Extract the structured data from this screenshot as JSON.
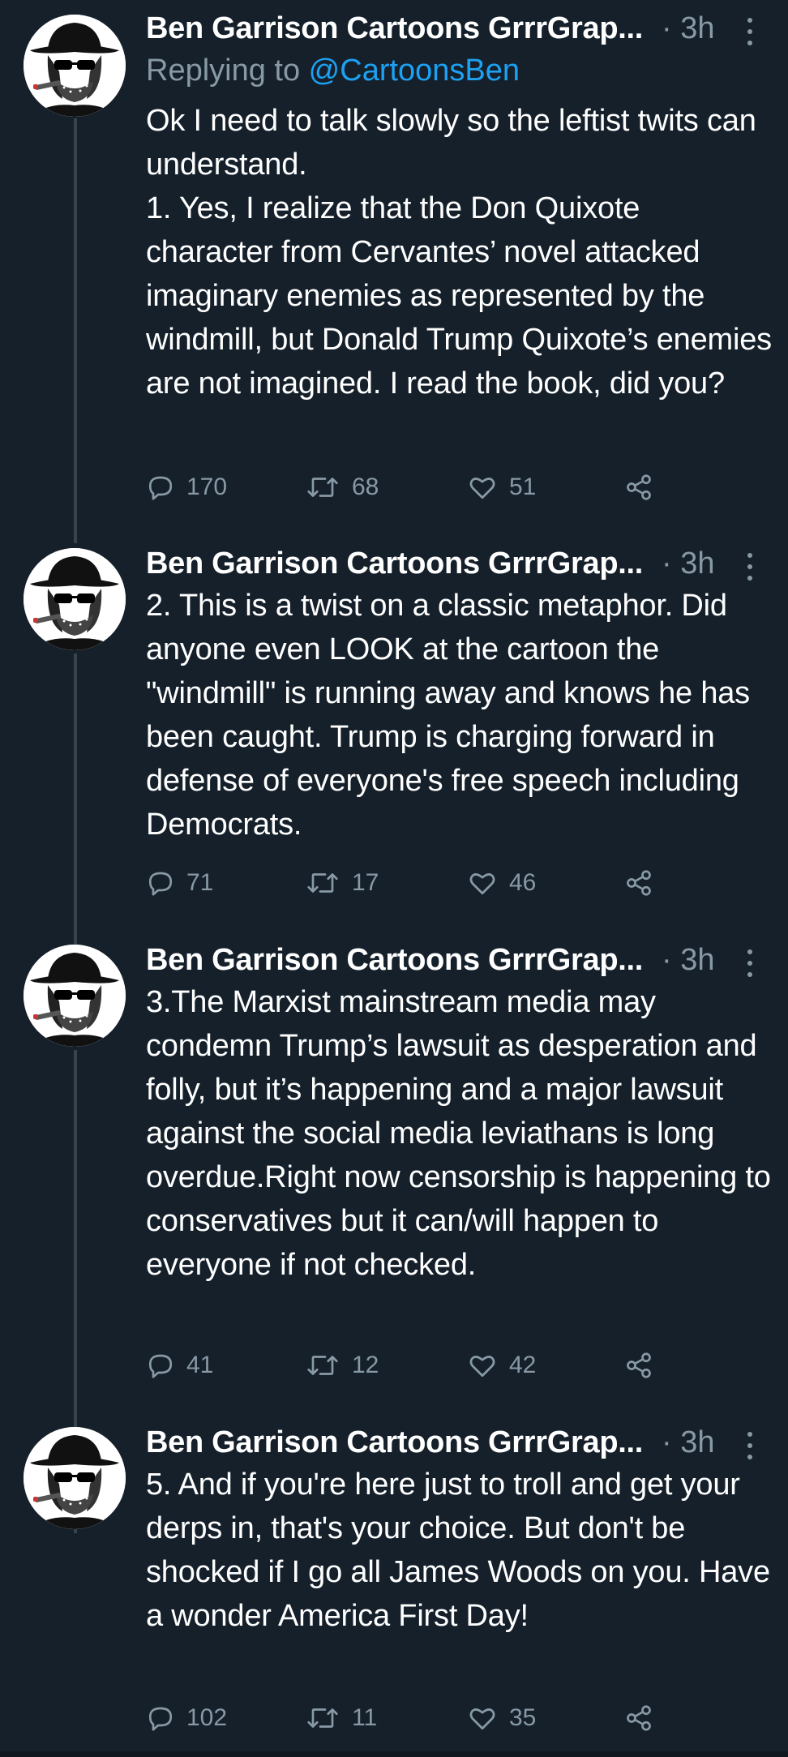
{
  "colors": {
    "background": "#15202b",
    "text_primary": "#ffffff",
    "text_secondary": "#8899a6",
    "link": "#1da1f2",
    "thread_line": "#38444d"
  },
  "tweets": [
    {
      "author": "Ben Garrison Cartoons GrrrGrap...",
      "time": "· 3h",
      "replying_label": "Replying to ",
      "replying_handle": "@CartoonsBen",
      "text": "Ok I need to talk slowly so the leftist twits can understand.\n1. Yes, I realize that the Don Quixote character from Cervantes’ novel attacked imaginary enemies as represented by the windmill, but Donald Trump Quixote’s enemies are not imagined. I read the book, did you?",
      "replies": "170",
      "retweets": "68",
      "likes": "51"
    },
    {
      "author": "Ben Garrison Cartoons GrrrGrap...",
      "time": "· 3h",
      "text": "2. This is a twist on a classic metaphor. Did anyone even LOOK at the cartoon the \"windmill\" is running away and knows he has been caught. Trump is charging forward in defense of everyone's free speech including Democrats.",
      "replies": "71",
      "retweets": "17",
      "likes": "46"
    },
    {
      "author": "Ben Garrison Cartoons GrrrGrap...",
      "time": "· 3h",
      "text": "3.The Marxist mainstream media may condemn Trump’s lawsuit as desperation and folly, but it’s happening and a major lawsuit against the social media leviathans is long overdue.Right now censorship is happening to conservatives but it can/will happen to everyone if not checked.",
      "replies": "41",
      "retweets": "12",
      "likes": "42"
    },
    {
      "author": "Ben Garrison Cartoons GrrrGrap...",
      "time": "· 3h",
      "text": "5. And if you're here just to troll and get your derps in, that's your choice.  But don't be shocked if I go all James Woods on you.  Have a wonder America First Day!",
      "replies": "102",
      "retweets": "11",
      "likes": "35"
    }
  ],
  "icons": {
    "reply": "reply-icon",
    "retweet": "retweet-icon",
    "like": "heart-icon",
    "share": "share-icon",
    "more": "more-vertical-icon",
    "avatar": "avatar-cartoon-portrait"
  }
}
